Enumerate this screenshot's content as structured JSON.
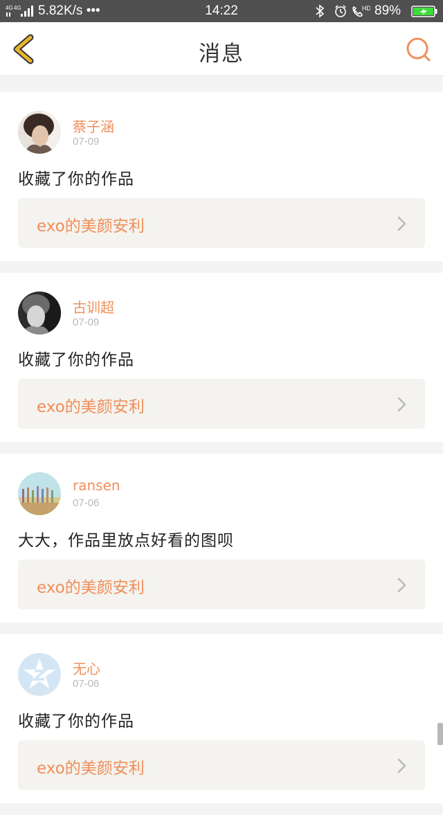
{
  "status_bar": {
    "network": "4G 4G",
    "speed": "5.82K/s",
    "more": "•••",
    "time": "14:22",
    "volte": "HD",
    "battery": "89%",
    "icons": [
      "bluetooth-icon",
      "alarm-icon",
      "phone-hd-icon",
      "battery-charging-icon"
    ]
  },
  "header": {
    "title": "消息",
    "back_icon": "chevron-left-icon",
    "search_icon": "search-icon"
  },
  "messages": [
    {
      "name": "蔡子涵",
      "date": "07-09",
      "text": "收藏了你的作品",
      "work": "exo的美颜安利"
    },
    {
      "name": "古训超",
      "date": "07-09",
      "text": "收藏了你的作品",
      "work": "exo的美颜安利"
    },
    {
      "name": "ransen",
      "date": "07-06",
      "text": "大大，作品里放点好看的图呗",
      "work": "exo的美颜安利"
    },
    {
      "name": "无心",
      "date": "07-06",
      "text": "收藏了你的作品",
      "work": "exo的美颜安利"
    }
  ],
  "colors": {
    "accent": "#f08e5a",
    "back_icon": "#e9b62c",
    "card_bg": "#ffffff",
    "work_bg": "#f4f3ef",
    "page_bg": "#f4f4f4"
  }
}
